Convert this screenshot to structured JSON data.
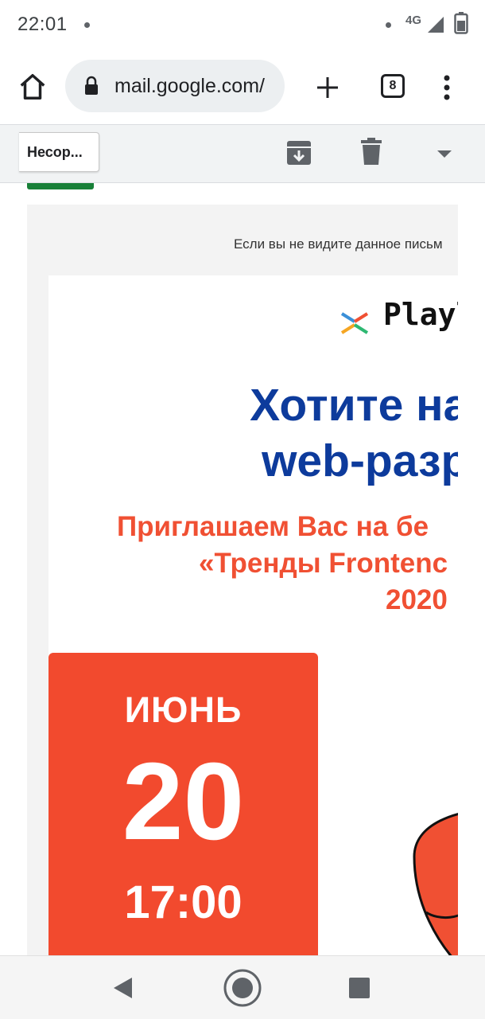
{
  "status_bar": {
    "time": "22:01",
    "network": "4G"
  },
  "browser": {
    "url": "mail.google.com/",
    "tab_count": "8"
  },
  "gmail_bar": {
    "back_label": "Несор..."
  },
  "email": {
    "preheader": "Если вы не видите данное письм",
    "logo_text": "Playl",
    "headline_line1": "Хотите нау",
    "headline_line2": "web-разра",
    "subtitle_line1": "Приглашаем Вас на бе",
    "subtitle_line2": "«Тренды Frontenc",
    "subtitle_line3": "2020",
    "date_month": "ИЮНЬ",
    "date_day": "20",
    "date_time": "17:00"
  },
  "colors": {
    "headline": "#0d3b9c",
    "subtitle": "#f05033",
    "date_block": "#f24a2e",
    "omnibox": "#eceff1"
  },
  "icons": [
    "home-icon",
    "lock-icon",
    "new-tab-icon",
    "tab-switcher-icon",
    "menu-dots-icon",
    "archive-icon",
    "trash-icon",
    "dropdown-icon",
    "back-nav-icon",
    "home-nav-icon",
    "recents-nav-icon"
  ]
}
